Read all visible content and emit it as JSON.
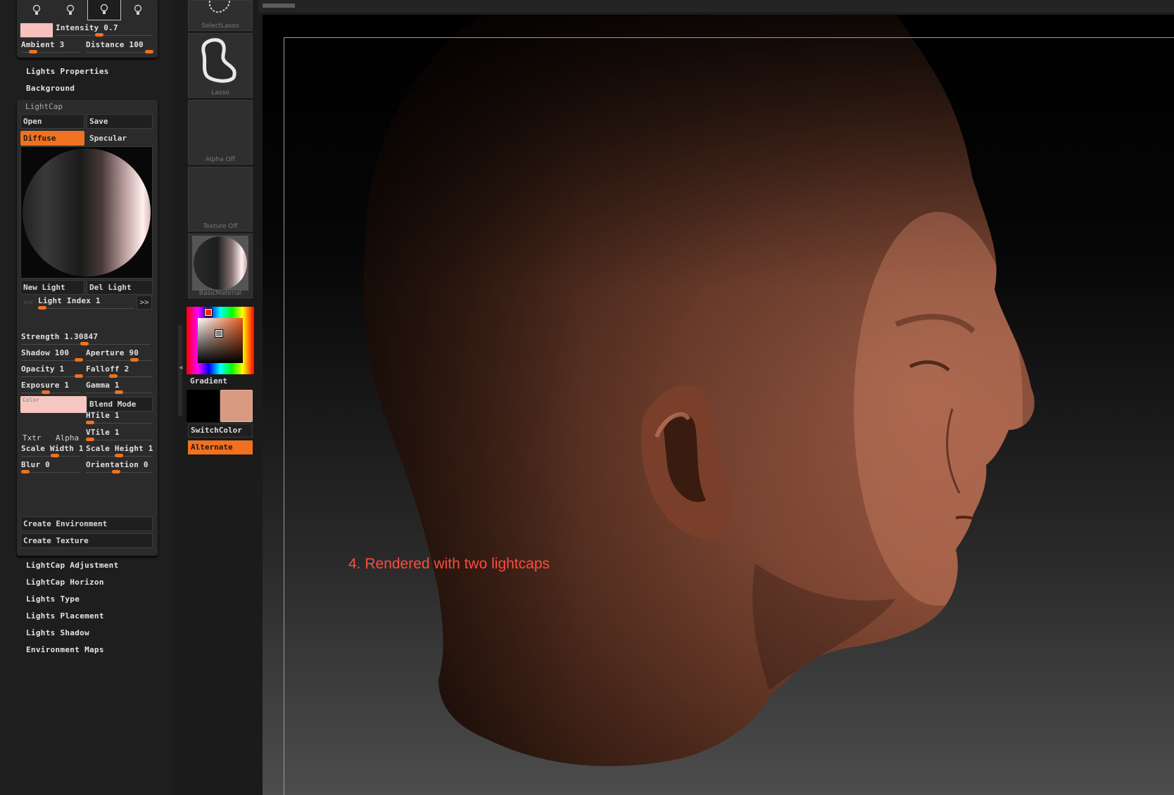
{
  "light_panel": {
    "intensity": "Intensity 0.7",
    "ambient": "Ambient 3",
    "distance": "Distance 100",
    "light_color": "#f6c0bc",
    "intensity_level": 0.55,
    "ambient_level": 0.15,
    "distance_level": 0.97
  },
  "menu_top": {
    "lights_properties": "Lights Properties",
    "background": "Background"
  },
  "lightcap": {
    "title": "LightCap",
    "open": "Open",
    "save": "Save",
    "diffuse": "Diffuse",
    "specular": "Specular",
    "new_light": "New Light",
    "del_light": "Del Light",
    "prev": "<<",
    "next": ">>",
    "light_index": "Light Index 1",
    "strength": "Strength 1.30847",
    "shadow": "Shadow 100",
    "aperture": "Aperture 90",
    "opacity": "Opacity 1",
    "falloff": "Falloff 2",
    "exposure": "Exposure 1",
    "gamma": "Gamma 1",
    "color_label": "Color",
    "blend_mode": "Blend Mode",
    "txtr": "Txtr",
    "alpha": "Alpha",
    "htile": "HTile 1",
    "vtile": "VTile 1",
    "scale_width": "Scale Width 1",
    "scale_height": "Scale Height 1",
    "blur": "Blur 0",
    "orientation": "Orientation 0",
    "create_environment": "Create Environment",
    "create_texture": "Create Texture",
    "accent_color": "#f0711f"
  },
  "menu_bottom": {
    "adjustment": "LightCap Adjustment",
    "horizon": "LightCap Horizon",
    "type": "Lights Type",
    "placement": "Lights Placement",
    "shadow": "Lights Shadow",
    "env_maps": "Environment Maps"
  },
  "tools": {
    "select_lasso": "SelectLasso",
    "lasso": "Lasso",
    "alpha_off": "Alpha  Off",
    "texture_off": "Texture  Off",
    "material": "BasicMaterial",
    "gradient": "Gradient",
    "switch_color": "SwitchColor",
    "alternate": "Alternate",
    "main_color": "#000000",
    "secondary_color": "#d89a80"
  },
  "canvas": {
    "caption": "4. Rendered with two lightcaps"
  }
}
